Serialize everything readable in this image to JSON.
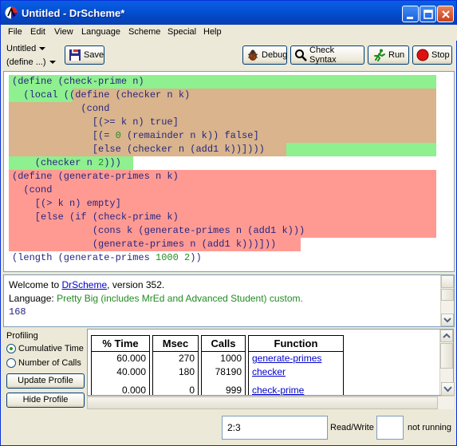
{
  "window": {
    "title": "Untitled - DrScheme*"
  },
  "menu": [
    "File",
    "Edit",
    "View",
    "Language",
    "Scheme",
    "Special",
    "Help"
  ],
  "toolbar": {
    "filename": "Untitled",
    "define_menu": "(define ...)",
    "save_label": "Save",
    "debug_label": "Debug",
    "check_syntax_label": "Check Syntax",
    "run_label": "Run",
    "stop_label": "Stop"
  },
  "editor": {
    "lines": [
      "(define (check-prime n)",
      "  (local ((define (checker n k)",
      "            (cond",
      "              [(>= k n) true]",
      "              [(= 0 (remainder n k)) false]",
      "              [else (checker n (add1 k))])))",
      "    (checker n 2)))",
      "(define (generate-primes n k)",
      "  (cond",
      "    [(> k n) empty]",
      "    [else (if (check-prime k)",
      "              (cons k (generate-primes n (add1 k)))",
      "              (generate-primes n (add1 k)))]))",
      "(length (generate-primes 1000 2))"
    ],
    "colors": {
      "green": "#8ef08e",
      "tan": "#d9b48c",
      "red": "#ff9a93"
    }
  },
  "repl": {
    "welcome_prefix": "Welcome to ",
    "welcome_link": "DrScheme",
    "welcome_suffix": ", version 352.",
    "language_prefix": "Language: ",
    "language_value": "Pretty Big (includes MrEd and Advanced Student) custom.",
    "result": "168"
  },
  "profiling": {
    "label": "Profiling",
    "options": [
      "Cumulative Time",
      "Number of Calls"
    ],
    "selected": "Cumulative Time",
    "update_label": "Update Profile",
    "hide_label": "Hide Profile",
    "headers": {
      "time": "% Time",
      "msec": "Msec",
      "calls": "Calls",
      "function": "Function"
    },
    "rows": [
      {
        "time": "60.000",
        "msec": "270",
        "calls": "1000",
        "function": "generate-primes"
      },
      {
        "time": "40.000",
        "msec": "180",
        "calls": "78190",
        "function": "checker"
      },
      {
        "time": "0.000",
        "msec": "0",
        "calls": "999",
        "function": "check-prime"
      }
    ]
  },
  "status": {
    "position": "2:3",
    "mode": "Read/Write",
    "running": "not running"
  }
}
